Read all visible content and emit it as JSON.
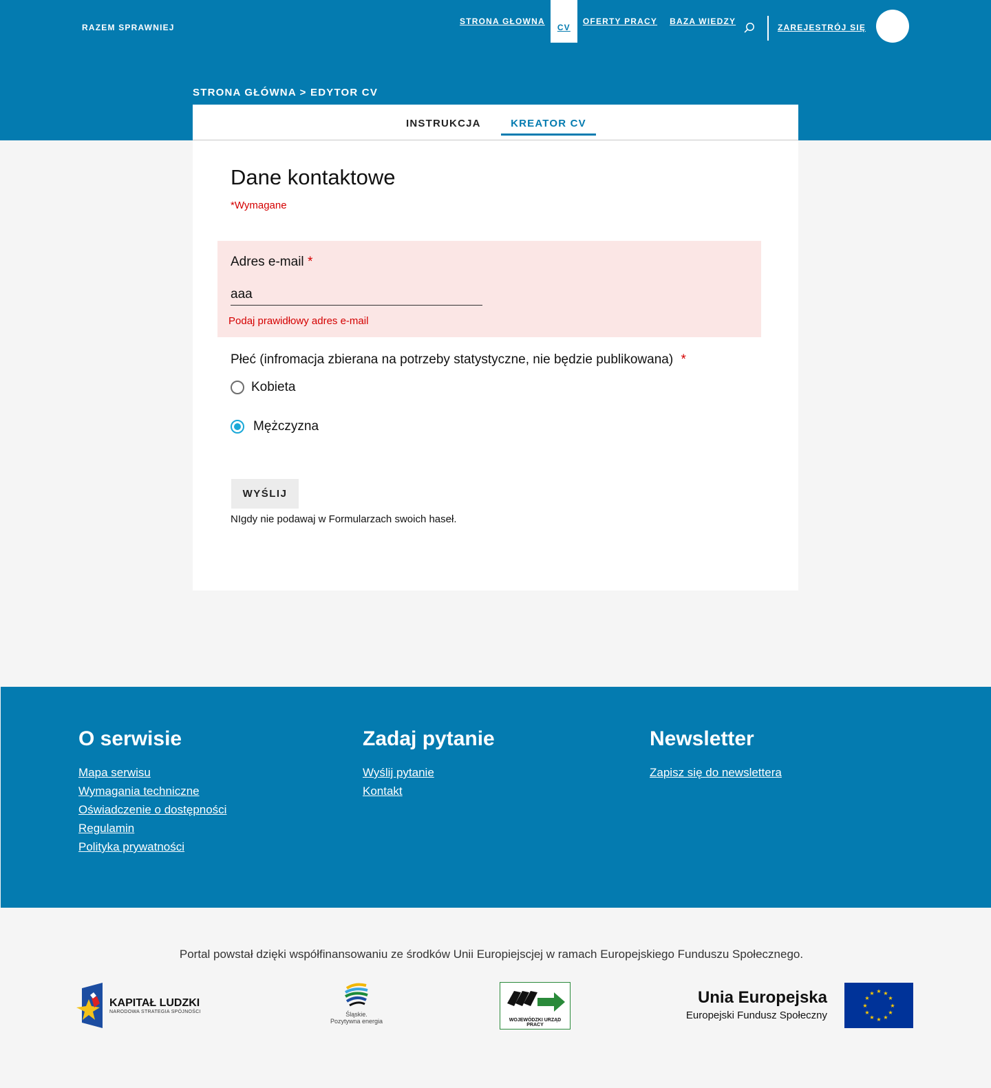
{
  "header": {
    "brand": "RAZEM SPRAWNIEJ",
    "nav": [
      {
        "label": "STRONA GŁOWNA",
        "active": false
      },
      {
        "label": "CV",
        "active": true
      },
      {
        "label": "OFERTY PRACY",
        "active": false
      },
      {
        "label": "BAZA WIEDZY",
        "active": false
      }
    ],
    "register": "ZAREJESTRÓJ SIĘ",
    "breadcrumb": "STRONA GŁÓWNA > EDYTOR CV",
    "color": "#047bb0"
  },
  "tabs": [
    {
      "label": "INSTRUKCJA",
      "active": false
    },
    {
      "label": "KREATOR CV",
      "active": true
    }
  ],
  "form": {
    "title": "Dane kontaktowe",
    "required_note": "*Wymagane",
    "email": {
      "label": "Adres e-mail",
      "required_mark": "*",
      "value": "aaa",
      "error": "Podaj prawidłowy adres e-mail"
    },
    "gender": {
      "label": "Płeć (infromacja zbierana na potrzeby statystyczne, nie będzie publikowana)",
      "required_mark": "*",
      "options": [
        {
          "label": "Kobieta",
          "checked": false
        },
        {
          "label": "Mężczyzna",
          "checked": true
        }
      ]
    },
    "submit_label": "WYŚLIJ",
    "password_note": "NIgdy nie podawaj w Formularzach swoich haseł."
  },
  "footer": {
    "about": {
      "title": "O serwisie",
      "links": [
        "Mapa serwisu",
        "Wymagania techniczne",
        "Oświadczenie o dostępności",
        "Regulamin",
        "Polityka prywatności"
      ]
    },
    "ask": {
      "title": "Zadaj pytanie",
      "links": [
        "Wyślij pytanie",
        "Kontakt"
      ]
    },
    "newsletter": {
      "title": "Newsletter",
      "links": [
        "Zapisz się do newslettera"
      ]
    }
  },
  "cofunding_text": "Portal powstał dzięki współfinansowaniu ze środków Unii Europiejscjej w ramach Europejskiego Funduszu Społecznego.",
  "logos": {
    "kapital_title": "KAPITAŁ LUDZKI",
    "kapital_sub": "NARODOWA STRATEGIA SPÓJNOŚCI",
    "slaskie_1": "Śląskie.",
    "slaskie_2": "Pozytywna energia",
    "wup": "WOJEWÓDZKI URZĄD PRACY",
    "ue_title": "Unia Europejska",
    "ue_sub": "Europejski Fundusz Społeczny"
  }
}
